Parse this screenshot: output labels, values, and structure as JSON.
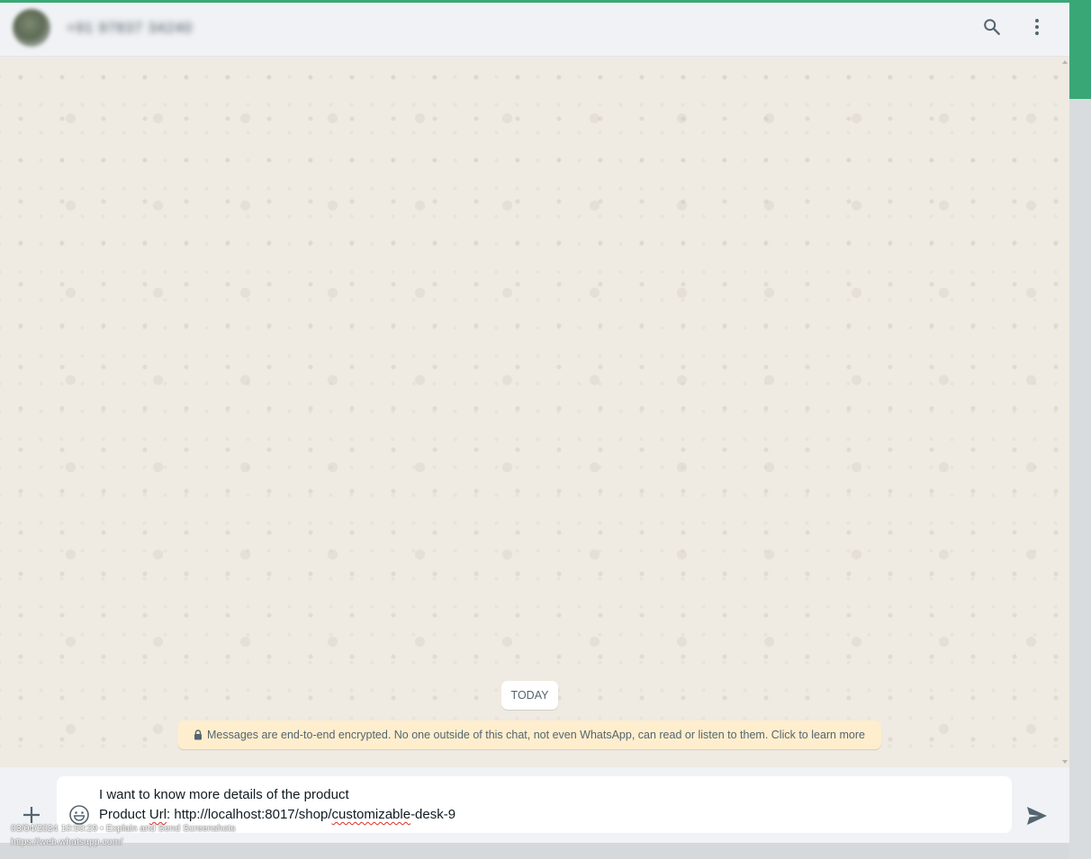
{
  "header": {
    "contact_name": "+91 97837 34240",
    "search_icon": "search-icon",
    "menu_icon": "kebab-menu-icon"
  },
  "chat": {
    "date_label": "TODAY",
    "encryption_notice": "Messages are end-to-end encrypted. No one outside of this chat, not even WhatsApp, can read or listen to them. Click to learn more"
  },
  "composer": {
    "line1": "I want to know more details of the product",
    "line2_prefix": "Product ",
    "line2_word1": "Url",
    "line2_mid": ": http://localhost:8017/shop/",
    "line2_word2": "customizable",
    "line2_suffix": "-desk-9",
    "attach_icon": "plus-icon",
    "emoji_icon": "emoji-icon",
    "send_icon": "send-icon"
  },
  "capture": {
    "line1": "03/04/2024 10:50:29 • Explain and Send Screenshots",
    "line2": "https://web.whatsapp.com/"
  },
  "colors": {
    "accent": "#3aa876",
    "chat_bg": "#efeae2",
    "header_bg": "#f0f2f5",
    "notice_bg": "#ffeecd"
  }
}
